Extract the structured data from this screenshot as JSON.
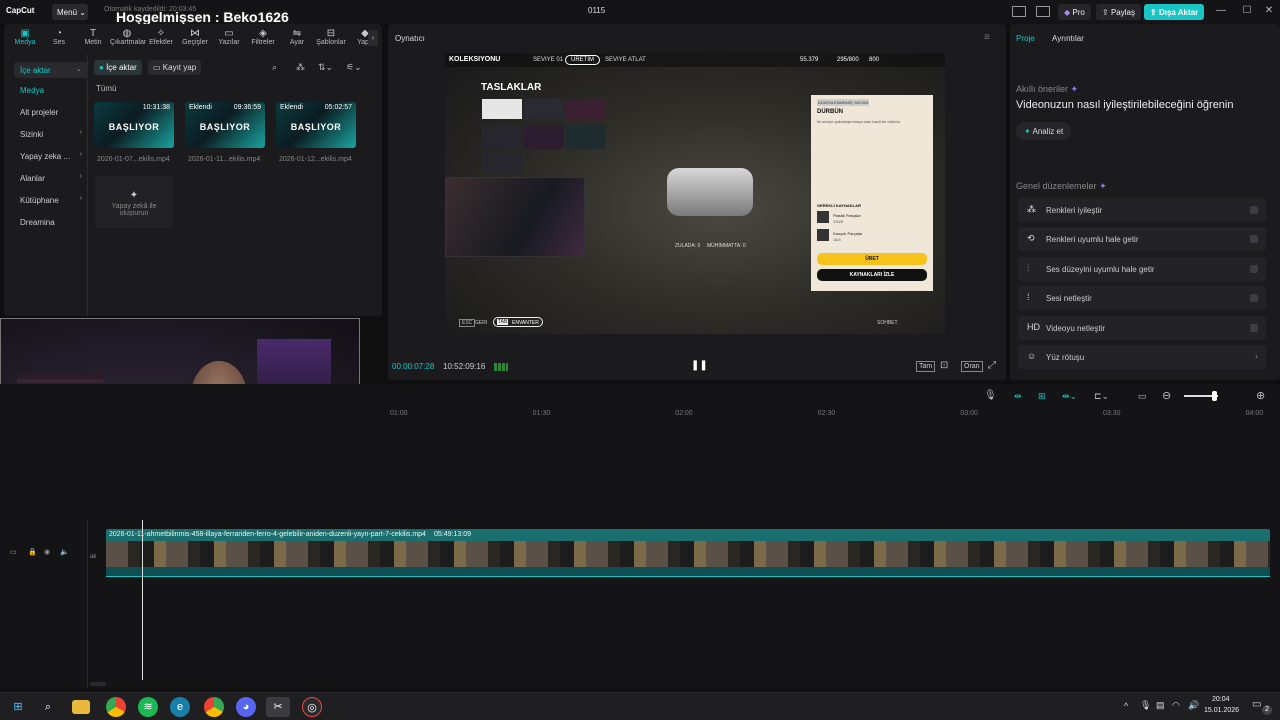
{
  "titlebar": {
    "logo": "CapCut",
    "menu": "Menü",
    "saved": "Otomatik kaydedildi: 20:03:45",
    "welcome": "Hoşgelmişsen : Beko1626",
    "project": "0115",
    "pro": "Pro",
    "share": "Paylaş",
    "export": "Dışa Aktar"
  },
  "tools": [
    {
      "label": "Medya",
      "icon": "media-icon"
    },
    {
      "label": "Ses",
      "icon": "audio-icon"
    },
    {
      "label": "Metin",
      "icon": "text-icon"
    },
    {
      "label": "Çıkartmalar",
      "icon": "sticker-icon"
    },
    {
      "label": "Efektler",
      "icon": "effects-icon"
    },
    {
      "label": "Geçişler",
      "icon": "transitions-icon"
    },
    {
      "label": "Yazılar",
      "icon": "captions-icon"
    },
    {
      "label": "Filtreler",
      "icon": "filters-icon"
    },
    {
      "label": "Ayar",
      "icon": "adjust-icon"
    },
    {
      "label": "Şablonlar",
      "icon": "templates-icon"
    },
    {
      "label": "Yapa",
      "icon": "ai-icon"
    }
  ],
  "sidenav": [
    {
      "label": "İçe aktar",
      "chev": "⌄"
    },
    {
      "label": "Medya",
      "chev": ""
    },
    {
      "label": "Alt projeler",
      "chev": ""
    },
    {
      "label": "Sizinki",
      "chev": "›"
    },
    {
      "label": "Yapay zeka ...",
      "chev": "›"
    },
    {
      "label": "Alanlar",
      "chev": "›"
    },
    {
      "label": "Kütüphane",
      "chev": "›"
    },
    {
      "label": "Dreamina",
      "chev": ""
    }
  ],
  "media": {
    "import_btn": "İçe aktar",
    "record_btn": "Kayıt yap",
    "filter_all": "Tümü",
    "ai_create": "Yapay zekâ ile oluşturun",
    "clips": [
      {
        "badge": "",
        "duration": "10:31:38",
        "word": "BAŞLIYOR",
        "name": "2026-01-07...ekilis.mp4"
      },
      {
        "badge": "Eklendi",
        "duration": "09:36:59",
        "word": "BAŞLIYOR",
        "name": "2026-01-11...ekilis.mp4"
      },
      {
        "badge": "Eklendi",
        "duration": "05:02:57",
        "word": "BAŞLIYOR",
        "name": "2026-01-12...ekilis.mp4"
      }
    ]
  },
  "player": {
    "title": "Oynatıcı",
    "current_time": "00:00:07:28",
    "total_time": "10:52:09:16",
    "full_btn": "Tam",
    "ratio_btn": "Oran",
    "game": {
      "nav_tabs": [
        "KOLEKSIYONU",
        "SEVIYE 01",
        "ÜRETIM",
        "SEVIYE ATLAT"
      ],
      "money": "55.379",
      "xp": "295/800",
      "gold": "800",
      "title": "TASLAKLAR",
      "card_tag": "DÜZENLENMEMİŞ  YAYGIN",
      "card_title": "DÜRBÜN",
      "card_desc": "İki seviye yakınlaştırmaya olan basit bir dürbün.",
      "resources_title": "GEREKLİ KAYNAKLAR",
      "res1": "Plastik Parçalar",
      "res1_qty": "100/8",
      "res2": "Kauçuk Parçalar",
      "res2_qty": "18/4",
      "craft_btn": "ÜRET",
      "track_btn": "KAYNAKLARI İZLE",
      "zulada": "ZULADA: 0",
      "muhimmatta": "MÜHİMMATTA: 0",
      "back": "GERI",
      "inventory": "ENVANTER",
      "tab_key": "TAB",
      "chat": "SOHBET",
      "esc": "ESC"
    }
  },
  "right": {
    "tab_project": "Proje",
    "tab_details": "Ayrıntılar",
    "ai_title": "Akıllı öneriler",
    "ai_desc": "Videonuzun nasıl iyileştirilebileceğini öğrenin",
    "analyze": "Analiz et",
    "general": "Genel düzenlemeler",
    "options": [
      {
        "label": "Renkleri iyileştir",
        "icon": "wand-icon"
      },
      {
        "label": "Renkleri uyumlu hale getir",
        "icon": "color-match-icon"
      },
      {
        "label": "Ses düzeyini uyumlu hale getir",
        "icon": "volume-sliders-icon"
      },
      {
        "label": "Sesi netleştir",
        "icon": "waveform-icon"
      },
      {
        "label": "Videoyu netleştir",
        "icon": "hd-icon"
      },
      {
        "label": "Yüz rötuşu",
        "icon": "face-icon"
      }
    ]
  },
  "timeline": {
    "ticks": [
      "01:00",
      "01:30",
      "02:00",
      "02:30",
      "03:00",
      "03:30",
      "04:00"
    ],
    "clip_name": "2026-01-11-ahmetbilinmis-458-illaya-ferrariden-ferro-4-gelebilir-aniden-duzenli-yayn-part-7-cekilis.mp4",
    "clip_duration": "05:49:13:09",
    "track_label": "ak"
  },
  "taskbar": {
    "time": "20:04",
    "date": "15.01.2026",
    "notif": "2"
  },
  "colors": {
    "accent": "#17c6c4",
    "panel": "#1b1b1e",
    "bg": "#0f0f10"
  }
}
